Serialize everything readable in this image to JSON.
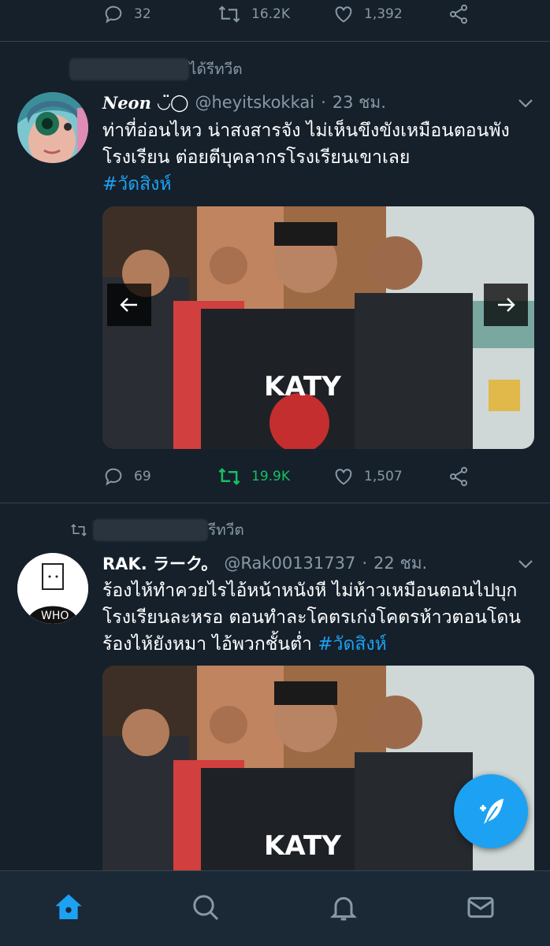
{
  "colors": {
    "background": "#15202b",
    "accent": "#1da1f2",
    "retweet_green": "#17bf63",
    "muted": "#8899a6"
  },
  "top_actions": {
    "replies": "32",
    "retweets": "16.2K",
    "likes": "1,392"
  },
  "tweets": [
    {
      "retweet_suffix": "ได้รีทวีต",
      "name": "Neon",
      "name_emoji": "◡̈◯",
      "handle": "@heyitskokkai",
      "time": "23 ชม.",
      "text": "ท่าที่อ่อนไหว น่าสงสารจัง ไม่เห็นขึงขังเหมือนตอนพังโรงเรียน ต่อยตีบุคลากรโรงเรียนเขาเลย",
      "hashtag": "#วัดสิงห์",
      "actions": {
        "replies": "69",
        "retweets": "19.9K",
        "likes": "1,507"
      }
    },
    {
      "retweet_suffix": "รีทวีต",
      "name": "RAK. ラーク。",
      "handle": "@Rak00131737",
      "time": "22 ชม.",
      "text": "ร้องไห้ทำควยไรไอ้หน้าหนังหี ไม่ห้าวเหมือนตอนไปบุกโรงเรียนละหรอ ตอนทำละโคตรเก่งโคตรห้าวตอนโดนร้องไห้ยังหมา ไอ้พวกชั้นต่ำ",
      "hashtag": "#วัดสิงห์",
      "avatar_text": "WHO"
    }
  ],
  "media_shirt_text": "KATY",
  "icons": [
    "reply-icon",
    "retweet-icon",
    "like-icon",
    "share-icon",
    "chevron-down-icon",
    "prev-arrow-icon",
    "next-arrow-icon",
    "compose-icon",
    "home-icon",
    "search-icon",
    "notifications-icon",
    "messages-icon"
  ]
}
